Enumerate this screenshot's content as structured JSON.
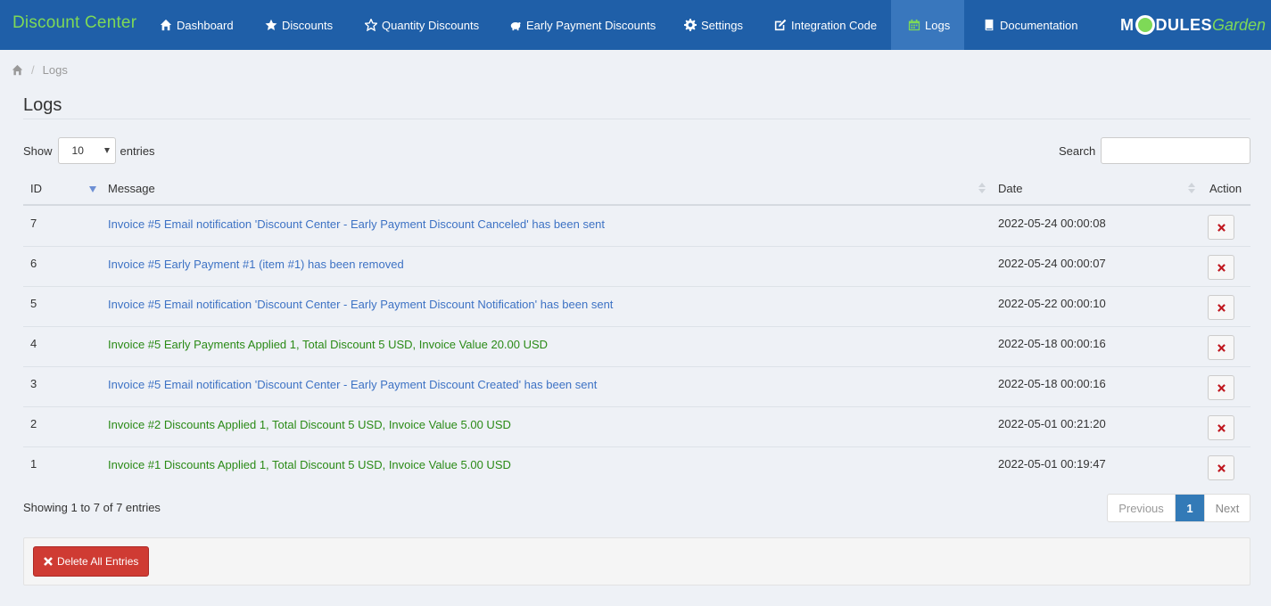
{
  "nav": {
    "brand": "Discount Center",
    "items": [
      {
        "label": "Dashboard",
        "icon": "home-icon"
      },
      {
        "label": "Discounts",
        "icon": "star-icon"
      },
      {
        "label": "Quantity Discounts",
        "icon": "star-outline-icon"
      },
      {
        "label": "Early Payment Discounts",
        "icon": "piggy-bank-icon"
      },
      {
        "label": "Settings",
        "icon": "gear-icon"
      },
      {
        "label": "Integration Code",
        "icon": "edit-icon"
      },
      {
        "label": "Logs",
        "icon": "calendar-icon",
        "active": true
      },
      {
        "label": "Documentation",
        "icon": "book-icon"
      }
    ],
    "logo": {
      "part1": "M",
      "part2": "DULES",
      "part3": "Garden"
    }
  },
  "breadcrumb": {
    "current": "Logs"
  },
  "page": {
    "title": "Logs"
  },
  "length": {
    "show_label": "Show",
    "value": "10",
    "entries_label": "entries"
  },
  "search": {
    "label": "Search",
    "value": ""
  },
  "table": {
    "headers": {
      "id": "ID",
      "message": "Message",
      "date": "Date",
      "action": "Action"
    },
    "rows": [
      {
        "id": "7",
        "message": "Invoice #5 Email notification 'Discount Center - Early Payment Discount Canceled' has been sent",
        "type": "info",
        "date": "2022-05-24 00:00:08"
      },
      {
        "id": "6",
        "message": "Invoice #5 Early Payment #1 (item #1) has been removed",
        "type": "info",
        "date": "2022-05-24 00:00:07"
      },
      {
        "id": "5",
        "message": "Invoice #5 Email notification 'Discount Center - Early Payment Discount Notification' has been sent",
        "type": "info",
        "date": "2022-05-22 00:00:10"
      },
      {
        "id": "4",
        "message": "Invoice #5 Early Payments Applied 1, Total Discount 5 USD, Invoice Value 20.00 USD",
        "type": "success",
        "date": "2022-05-18 00:00:16"
      },
      {
        "id": "3",
        "message": "Invoice #5 Email notification 'Discount Center - Early Payment Discount Created' has been sent",
        "type": "info",
        "date": "2022-05-18 00:00:16"
      },
      {
        "id": "2",
        "message": "Invoice #2 Discounts Applied 1, Total Discount 5 USD, Invoice Value 5.00 USD",
        "type": "success",
        "date": "2022-05-01 00:21:20"
      },
      {
        "id": "1",
        "message": "Invoice #1 Discounts Applied 1, Total Discount 5 USD, Invoice Value 5.00 USD",
        "type": "success",
        "date": "2022-05-01 00:19:47"
      }
    ]
  },
  "info": "Showing 1 to 7 of 7 entries",
  "pagination": {
    "previous": "Previous",
    "current": "1",
    "next": "Next"
  },
  "actions": {
    "delete_all": "Delete All Entries"
  },
  "colors": {
    "nav_bg": "#1f5fa8",
    "brand": "#7ed957",
    "info_text": "#3d72c4",
    "success_text": "#2a8a16",
    "danger": "#cf3b33"
  }
}
